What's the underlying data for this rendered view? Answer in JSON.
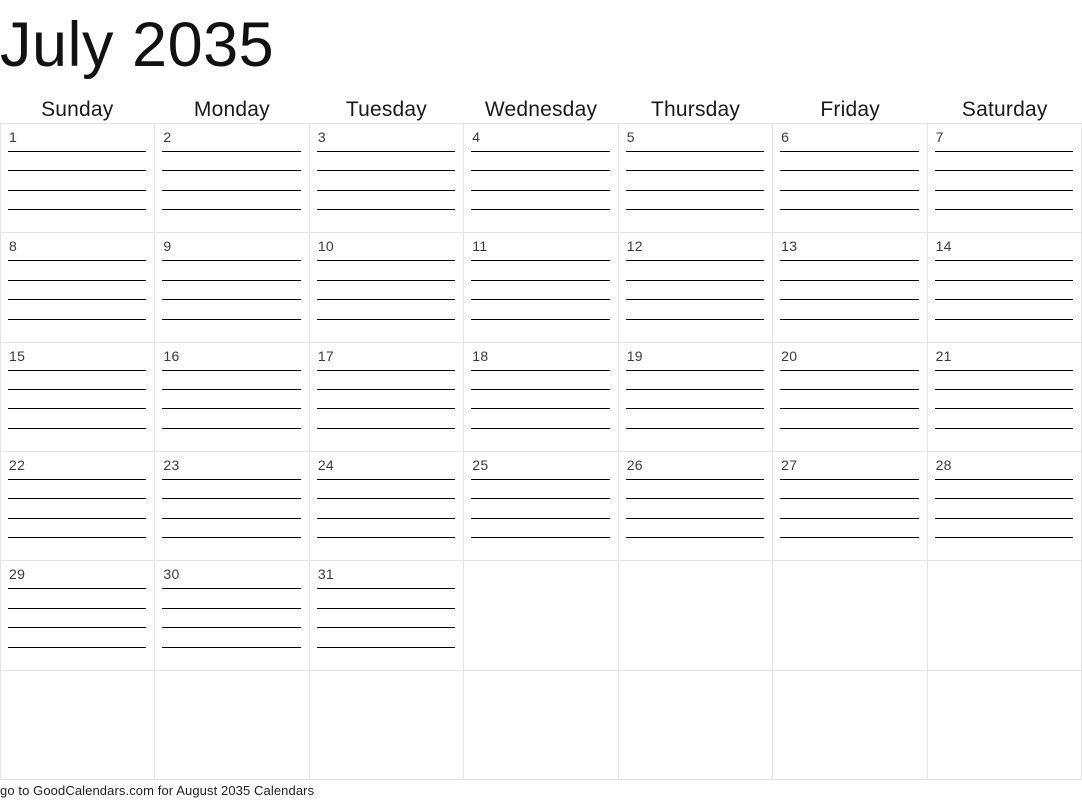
{
  "calendar": {
    "title": "July 2035",
    "month": "July",
    "year": "2035",
    "weekday_headers": [
      "Sunday",
      "Monday",
      "Tuesday",
      "Wednesday",
      "Thursday",
      "Friday",
      "Saturday"
    ],
    "lines_per_day": 4,
    "weeks": [
      [
        {
          "day": "1",
          "has_lines": true
        },
        {
          "day": "2",
          "has_lines": true
        },
        {
          "day": "3",
          "has_lines": true
        },
        {
          "day": "4",
          "has_lines": true
        },
        {
          "day": "5",
          "has_lines": true
        },
        {
          "day": "6",
          "has_lines": true
        },
        {
          "day": "7",
          "has_lines": true
        }
      ],
      [
        {
          "day": "8",
          "has_lines": true
        },
        {
          "day": "9",
          "has_lines": true
        },
        {
          "day": "10",
          "has_lines": true
        },
        {
          "day": "11",
          "has_lines": true
        },
        {
          "day": "12",
          "has_lines": true
        },
        {
          "day": "13",
          "has_lines": true
        },
        {
          "day": "14",
          "has_lines": true
        }
      ],
      [
        {
          "day": "15",
          "has_lines": true
        },
        {
          "day": "16",
          "has_lines": true
        },
        {
          "day": "17",
          "has_lines": true
        },
        {
          "day": "18",
          "has_lines": true
        },
        {
          "day": "19",
          "has_lines": true
        },
        {
          "day": "20",
          "has_lines": true
        },
        {
          "day": "21",
          "has_lines": true
        }
      ],
      [
        {
          "day": "22",
          "has_lines": true
        },
        {
          "day": "23",
          "has_lines": true
        },
        {
          "day": "24",
          "has_lines": true
        },
        {
          "day": "25",
          "has_lines": true
        },
        {
          "day": "26",
          "has_lines": true
        },
        {
          "day": "27",
          "has_lines": true
        },
        {
          "day": "28",
          "has_lines": true
        }
      ],
      [
        {
          "day": "29",
          "has_lines": true
        },
        {
          "day": "30",
          "has_lines": true
        },
        {
          "day": "31",
          "has_lines": true
        },
        {
          "day": "",
          "has_lines": false
        },
        {
          "day": "",
          "has_lines": false
        },
        {
          "day": "",
          "has_lines": false
        },
        {
          "day": "",
          "has_lines": false
        }
      ],
      [
        {
          "day": "",
          "has_lines": false
        },
        {
          "day": "",
          "has_lines": false
        },
        {
          "day": "",
          "has_lines": false
        },
        {
          "day": "",
          "has_lines": false
        },
        {
          "day": "",
          "has_lines": false
        },
        {
          "day": "",
          "has_lines": false
        },
        {
          "day": "",
          "has_lines": false
        }
      ]
    ],
    "footer": {
      "text": "go to GoodCalendars.com for August 2035 Calendars"
    },
    "colors": {
      "page_background": "#ffffff",
      "grid_border": "#e3e3e3",
      "rule_line": "#000000",
      "title_text": "#111111",
      "day_number_text": "#3a3a3a",
      "weekday_header_text": "#1a1a1a",
      "footer_text": "#1f1f1f"
    }
  }
}
